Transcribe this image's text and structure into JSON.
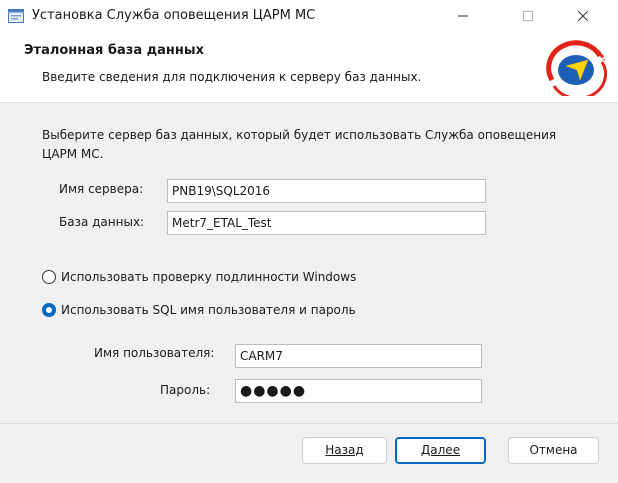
{
  "window": {
    "title": "Установка Служба оповещения ЦАРМ МС"
  },
  "header": {
    "title": "Эталонная база данных",
    "subtitle": "Введите сведения для подключения к серверу баз данных."
  },
  "content": {
    "description": "Выберите сервер баз данных, который будет использовать Служба оповещения ЦАРМ МС.",
    "server": {
      "label": "Имя сервера:",
      "value": "PNB19\\SQL2016"
    },
    "database": {
      "label": "База данных:",
      "value": "Metr7_ETAL_Test"
    },
    "auth_windows": {
      "label": "Использовать проверку подлинности Windows",
      "selected": false
    },
    "auth_sql": {
      "label": "Использовать SQL имя пользователя и пароль",
      "selected": true
    },
    "username": {
      "label": "Имя пользователя:",
      "value": "CARM7"
    },
    "password": {
      "label": "Пароль:",
      "value": "●●●●●"
    }
  },
  "buttons": {
    "back": "Назад",
    "next": "Далее",
    "cancel": "Отмена"
  },
  "colors": {
    "accent": "#0067c0",
    "logo_red": "#e2231a",
    "logo_blue": "#1d5fb4",
    "logo_yellow": "#ffd400"
  }
}
